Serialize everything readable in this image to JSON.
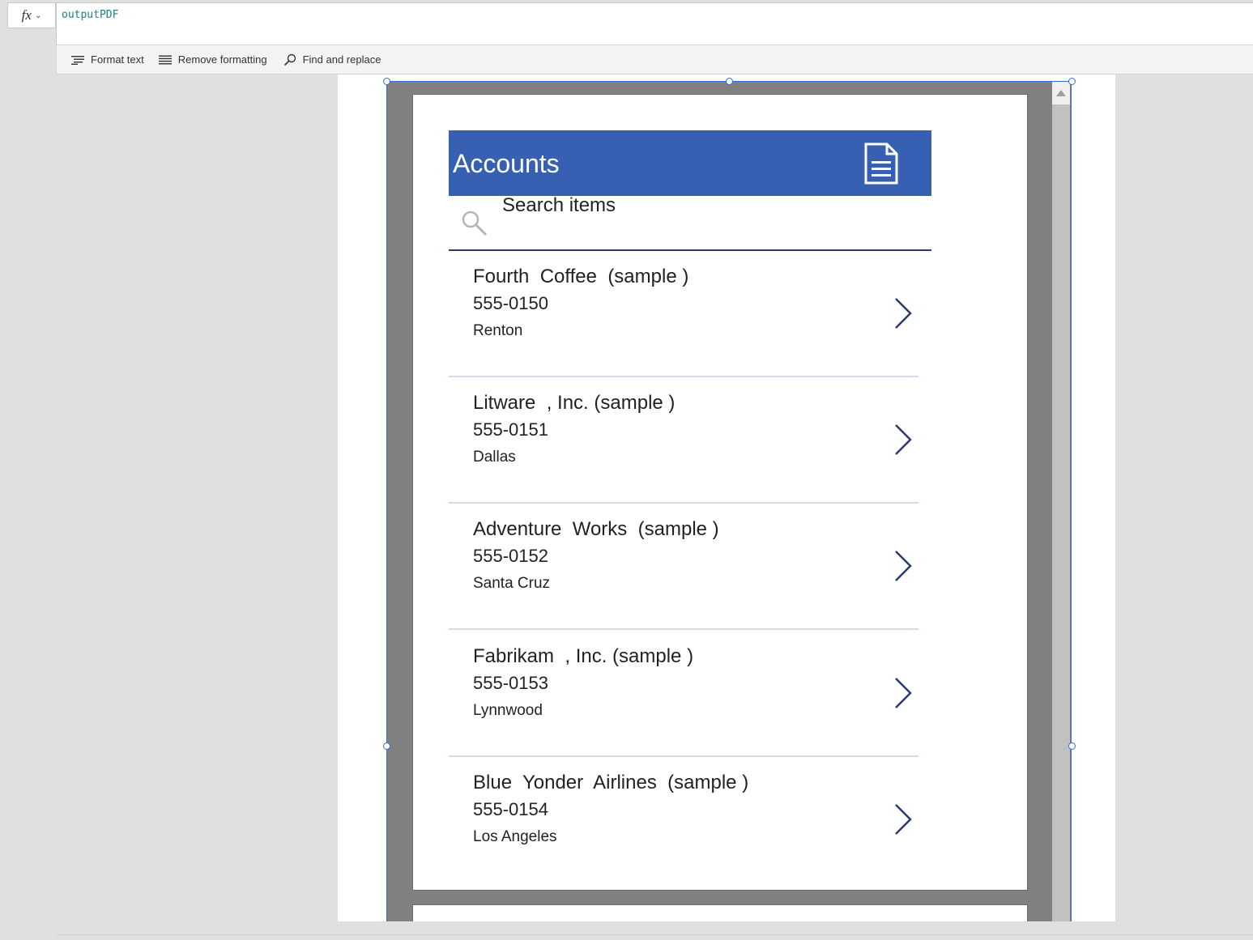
{
  "formula_bar": {
    "fx_label": "fx",
    "formula": "outputPDF"
  },
  "toolbar": {
    "format_text": "Format text",
    "remove_formatting": "Remove formatting",
    "find_replace": "Find and replace"
  },
  "app": {
    "header_title": "Accounts",
    "header_icon": "document-icon",
    "search_placeholder": "Search items",
    "accent_color": "#3860b2",
    "items": [
      {
        "name": "Fourth  Coffee  (sample )",
        "phone": "555-0150",
        "city": "Renton"
      },
      {
        "name": "Litware  , Inc. (sample )",
        "phone": "555-0151",
        "city": "Dallas"
      },
      {
        "name": "Adventure  Works  (sample )",
        "phone": "555-0152",
        "city": "Santa Cruz"
      },
      {
        "name": "Fabrikam  , Inc. (sample )",
        "phone": "555-0153",
        "city": "Lynnwood"
      },
      {
        "name": "Blue  Yonder  Airlines  (sample )",
        "phone": "555-0154",
        "city": "Los Angeles"
      }
    ]
  }
}
